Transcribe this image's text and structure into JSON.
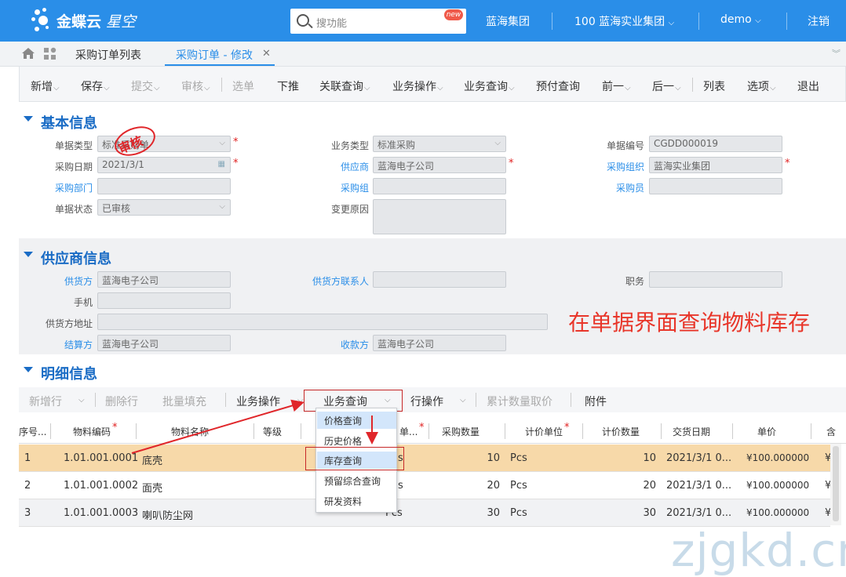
{
  "app": {
    "logo_text": "金蝶云",
    "logo_text2": "星空"
  },
  "top": {
    "search_placeholder": "搜功能",
    "new_badge": "new",
    "group": "蓝海集团",
    "org": "100 蓝海实业集团",
    "user": "demo",
    "logout": "注销"
  },
  "tabs": {
    "list": "采购订单列表",
    "active": "采购订单 - 修改"
  },
  "toolbar": {
    "new": "新增",
    "save": "保存",
    "submit": "提交",
    "audit": "审核",
    "pick": "选单",
    "push": "下推",
    "relquery": "关联查询",
    "bizop": "业务操作",
    "bizquery": "业务查询",
    "prepay": "预付查询",
    "prev": "前一",
    "next": "后一",
    "list": "列表",
    "options": "选项",
    "exit": "退出"
  },
  "basic": {
    "title": "基本信息",
    "stamp": "审核",
    "doc_type_label": "单据类型",
    "doc_type": "标准采购单",
    "biz_type_label": "业务类型",
    "biz_type": "标准采购",
    "doc_no_label": "单据编号",
    "doc_no": "CGDD000019",
    "date_label": "采购日期",
    "date": "2021/3/1",
    "supplier_label": "供应商",
    "supplier": "蓝海电子公司",
    "org_label": "采购组织",
    "org": "蓝海实业集团",
    "dept_label": "采购部门",
    "group_label": "采购组",
    "buyer_label": "采购员",
    "status_label": "单据状态",
    "status": "已审核",
    "reason_label": "变更原因"
  },
  "supplier": {
    "title": "供应商信息",
    "supply_label": "供货方",
    "supply": "蓝海电子公司",
    "contact_label": "供货方联系人",
    "position_label": "职务",
    "phone_label": "手机",
    "address_label": "供货方地址",
    "settle_label": "结算方",
    "settle": "蓝海电子公司",
    "receive_label": "收款方",
    "receive": "蓝海电子公司"
  },
  "annotation": "在单据界面查询物料库存",
  "detail": {
    "title": "明细信息",
    "toolbar": {
      "addrow": "新增行",
      "delrow": "删除行",
      "batchfill": "批量填充",
      "bizop": "业务操作",
      "bizquery": "业务查询",
      "rowop": "行操作",
      "cumprice": "累计数量取价",
      "attach": "附件"
    },
    "columns": {
      "seq": "序号...",
      "code": "物料编码",
      "name": "物料名称",
      "grade": "等级",
      "unit": "单...",
      "qty": "采购数量",
      "priceunit": "计价单位",
      "priceqty": "计价数量",
      "delivery": "交货日期",
      "price": "单价",
      "more": "含"
    },
    "rows": [
      {
        "seq": "1",
        "code": "1.01.001.0001",
        "name": "底壳",
        "unit": "s",
        "qty": "10",
        "priceunit": "Pcs",
        "priceqty": "10",
        "delivery": "2021/3/1 0...",
        "price": "¥100.000000",
        "more": "¥"
      },
      {
        "seq": "2",
        "code": "1.01.001.0002",
        "name": "面壳",
        "unit": "s",
        "qty": "20",
        "priceunit": "Pcs",
        "priceqty": "20",
        "delivery": "2021/3/1 0...",
        "price": "¥100.000000",
        "more": "¥"
      },
      {
        "seq": "3",
        "code": "1.01.001.0003",
        "name": "喇叭防尘网",
        "unit": "Pcs",
        "qty": "30",
        "priceunit": "Pcs",
        "priceqty": "30",
        "delivery": "2021/3/1 0...",
        "price": "¥100.000000",
        "more": "¥"
      }
    ],
    "menu": [
      "价格查询",
      "历史价格",
      "库存查询",
      "预留综合查询",
      "研发资料"
    ]
  },
  "watermark": "zjgkd.cn",
  "colors": {
    "brand": "#2a8ee8",
    "section": "#1a6cc5",
    "annotation": "#e8362a",
    "selected_row": "#f7d9a9"
  }
}
